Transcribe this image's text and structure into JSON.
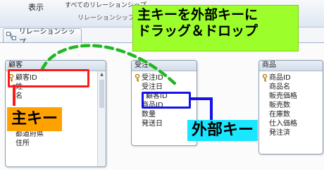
{
  "ribbon": {
    "view_label": "表示",
    "all_relationships_label": "すべてのリレーションシップ",
    "group_label": "リレーションシップ"
  },
  "tab": {
    "label": "リレーションシップ"
  },
  "tables": {
    "customer": {
      "title": "顧客",
      "fields": [
        "顧客ID",
        "姓",
        "名",
        "郵便番号",
        "都道府県",
        "住所"
      ]
    },
    "order": {
      "title": "受注",
      "fields": [
        "受注ID",
        "受注日",
        "顧客ID",
        "商品ID",
        "数量",
        "発送日"
      ]
    },
    "product": {
      "title": "商品",
      "fields": [
        "商品ID",
        "商品名",
        "販売価格",
        "販売数",
        "在庫数",
        "仕入価格",
        "発注済"
      ]
    }
  },
  "annotations": {
    "callout_line1": "主キーを外部キーに",
    "callout_line2": "ドラッグ＆ドロップ",
    "primary_key_label": "主キー",
    "foreign_key_label": "外部キー"
  },
  "colors": {
    "callout_bg": "#9cff2b",
    "primary_key_box": "#ff1a1a",
    "primary_key_label_bg": "#ffa200",
    "foreign_key_box": "#1414e6",
    "foreign_key_label_bg": "#19e6ff",
    "drag_path": "#22b822"
  }
}
